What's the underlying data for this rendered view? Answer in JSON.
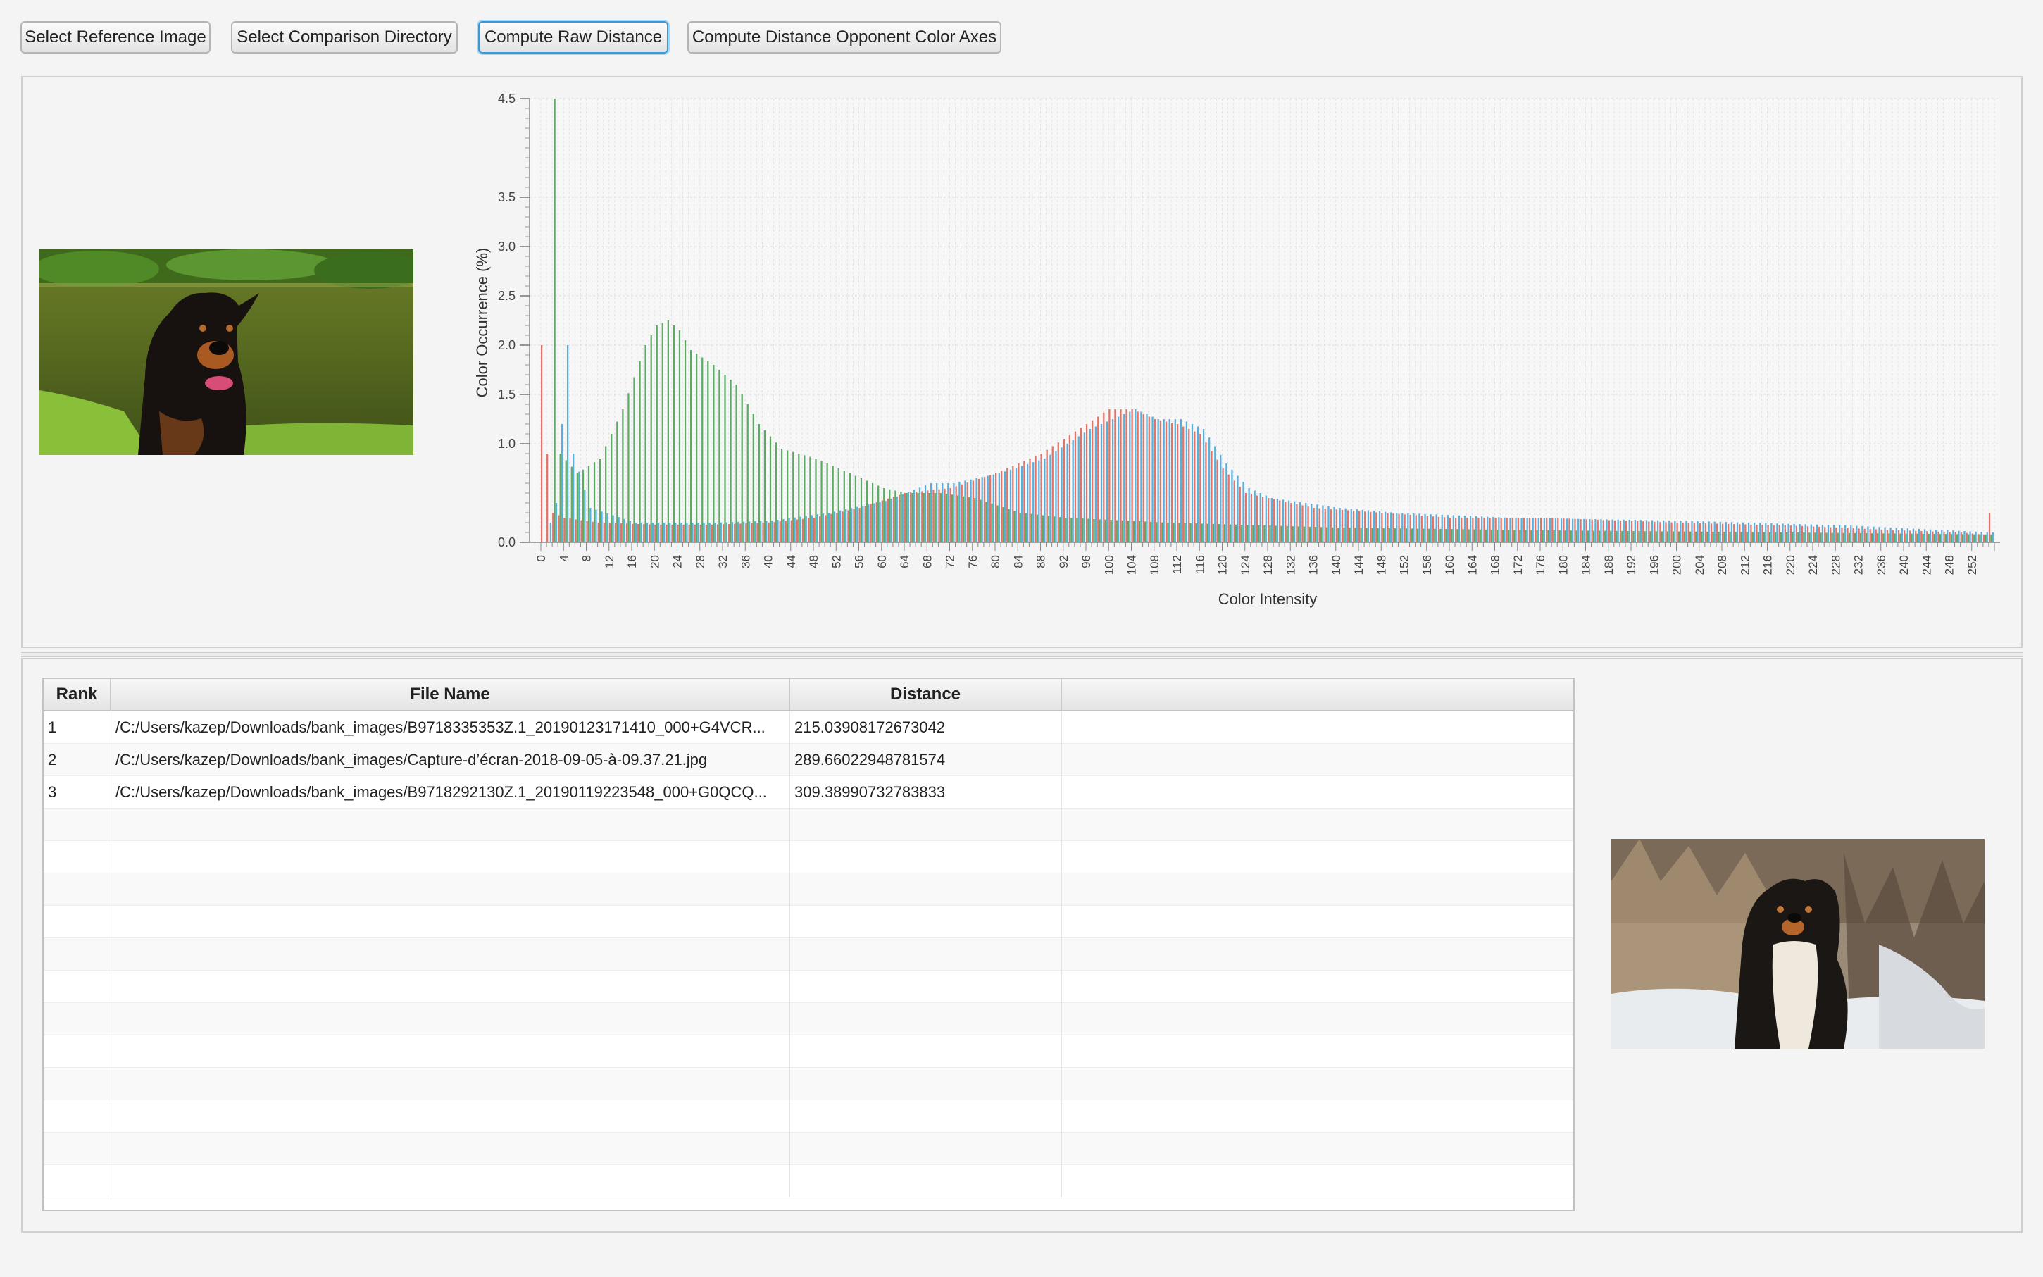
{
  "toolbar": {
    "buttons": [
      {
        "label": "Select Reference Image"
      },
      {
        "label": "Select Comparison Directory"
      },
      {
        "label": "Compute Raw Distance"
      },
      {
        "label": "Compute Distance Opponent Color Axes"
      }
    ]
  },
  "reference_image": {
    "description": "rottweiler-photo"
  },
  "comparison_image": {
    "description": "australian-shepherd-photo"
  },
  "chart_data": {
    "type": "bar",
    "title": "",
    "xlabel": "Color Intensity",
    "ylabel": "Color Occurrence (%)",
    "ylim": [
      0,
      4.5
    ],
    "y_ticks": [
      "0.0",
      "1.0",
      "1.5",
      "2.0",
      "2.5",
      "3.0",
      "3.5",
      "4.5"
    ],
    "x_ticks": [
      "0",
      "4",
      "8",
      "12",
      "16",
      "20",
      "24",
      "28",
      "32",
      "36",
      "40",
      "44",
      "48",
      "52",
      "56",
      "60",
      "64",
      "68",
      "72",
      "76",
      "80",
      "84",
      "88",
      "92",
      "96",
      "100",
      "104",
      "108",
      "112",
      "116",
      "120",
      "124",
      "128",
      "132",
      "136",
      "140",
      "144",
      "148",
      "152",
      "156",
      "160",
      "164",
      "168",
      "172",
      "176",
      "180",
      "184",
      "188",
      "192",
      "196",
      "200",
      "204",
      "208",
      "212",
      "216",
      "220",
      "224",
      "228",
      "232",
      "236",
      "240",
      "244",
      "248",
      "252"
    ],
    "grid": true,
    "series_colors": {
      "red": "#e05a4f",
      "green": "#3f9e4a",
      "blue": "#3aa2d8"
    },
    "series": [
      {
        "color": "red",
        "points": [
          [
            0,
            2.0
          ],
          [
            1,
            0.9
          ],
          [
            2,
            0.3
          ],
          [
            4,
            0.25
          ],
          [
            10,
            0.2
          ],
          [
            20,
            0.18
          ],
          [
            30,
            0.18
          ],
          [
            40,
            0.2
          ],
          [
            48,
            0.25
          ],
          [
            56,
            0.35
          ],
          [
            64,
            0.5
          ],
          [
            72,
            0.55
          ],
          [
            80,
            0.7
          ],
          [
            88,
            0.9
          ],
          [
            96,
            1.2
          ],
          [
            100,
            1.35
          ],
          [
            104,
            1.35
          ],
          [
            108,
            1.25
          ],
          [
            112,
            1.2
          ],
          [
            116,
            1.1
          ],
          [
            120,
            0.75
          ],
          [
            124,
            0.5
          ],
          [
            128,
            0.45
          ],
          [
            136,
            0.35
          ],
          [
            148,
            0.3
          ],
          [
            160,
            0.25
          ],
          [
            176,
            0.25
          ],
          [
            200,
            0.2
          ],
          [
            220,
            0.17
          ],
          [
            240,
            0.12
          ],
          [
            250,
            0.1
          ],
          [
            254,
            0.08
          ],
          [
            255,
            0.3
          ]
        ]
      },
      {
        "color": "green",
        "points": [
          [
            0,
            0.0
          ],
          [
            1,
            0.0
          ],
          [
            2,
            4.5
          ],
          [
            3,
            0.9
          ],
          [
            6,
            0.7
          ],
          [
            10,
            0.85
          ],
          [
            14,
            1.35
          ],
          [
            18,
            2.0
          ],
          [
            20,
            2.2
          ],
          [
            22,
            2.25
          ],
          [
            24,
            2.15
          ],
          [
            26,
            1.95
          ],
          [
            30,
            1.8
          ],
          [
            34,
            1.6
          ],
          [
            38,
            1.2
          ],
          [
            42,
            0.95
          ],
          [
            48,
            0.85
          ],
          [
            52,
            0.75
          ],
          [
            56,
            0.65
          ],
          [
            60,
            0.55
          ],
          [
            64,
            0.5
          ],
          [
            70,
            0.5
          ],
          [
            76,
            0.45
          ],
          [
            84,
            0.3
          ],
          [
            92,
            0.25
          ],
          [
            110,
            0.2
          ],
          [
            140,
            0.15
          ],
          [
            180,
            0.12
          ],
          [
            220,
            0.1
          ],
          [
            255,
            0.08
          ]
        ]
      },
      {
        "color": "blue",
        "points": [
          [
            0,
            0.0
          ],
          [
            2,
            0.4
          ],
          [
            4,
            2.0
          ],
          [
            5,
            0.9
          ],
          [
            8,
            0.35
          ],
          [
            16,
            0.2
          ],
          [
            30,
            0.2
          ],
          [
            40,
            0.22
          ],
          [
            50,
            0.3
          ],
          [
            60,
            0.42
          ],
          [
            68,
            0.6
          ],
          [
            72,
            0.6
          ],
          [
            80,
            0.7
          ],
          [
            88,
            0.85
          ],
          [
            96,
            1.15
          ],
          [
            104,
            1.35
          ],
          [
            108,
            1.25
          ],
          [
            112,
            1.25
          ],
          [
            116,
            1.15
          ],
          [
            120,
            0.8
          ],
          [
            124,
            0.55
          ],
          [
            128,
            0.45
          ],
          [
            140,
            0.35
          ],
          [
            150,
            0.3
          ],
          [
            170,
            0.25
          ],
          [
            200,
            0.22
          ],
          [
            230,
            0.17
          ],
          [
            255,
            0.1
          ]
        ]
      }
    ]
  },
  "table": {
    "columns": [
      "Rank",
      "File Name",
      "Distance"
    ],
    "rows": [
      {
        "rank": "1",
        "file": "/C:/Users/kazep/Downloads/bank_images/B9718335353Z.1_20190123171410_000+G4VCR...",
        "distance": "215.03908172673042"
      },
      {
        "rank": "2",
        "file": "/C:/Users/kazep/Downloads/bank_images/Capture-d’écran-2018-09-05-à-09.37.21.jpg",
        "distance": "289.66022948781574"
      },
      {
        "rank": "3",
        "file": "/C:/Users/kazep/Downloads/bank_images/B9718292130Z.1_20190119223548_000+G0QCQ...",
        "distance": "309.38990732783833"
      }
    ],
    "empty_rows": 12
  }
}
